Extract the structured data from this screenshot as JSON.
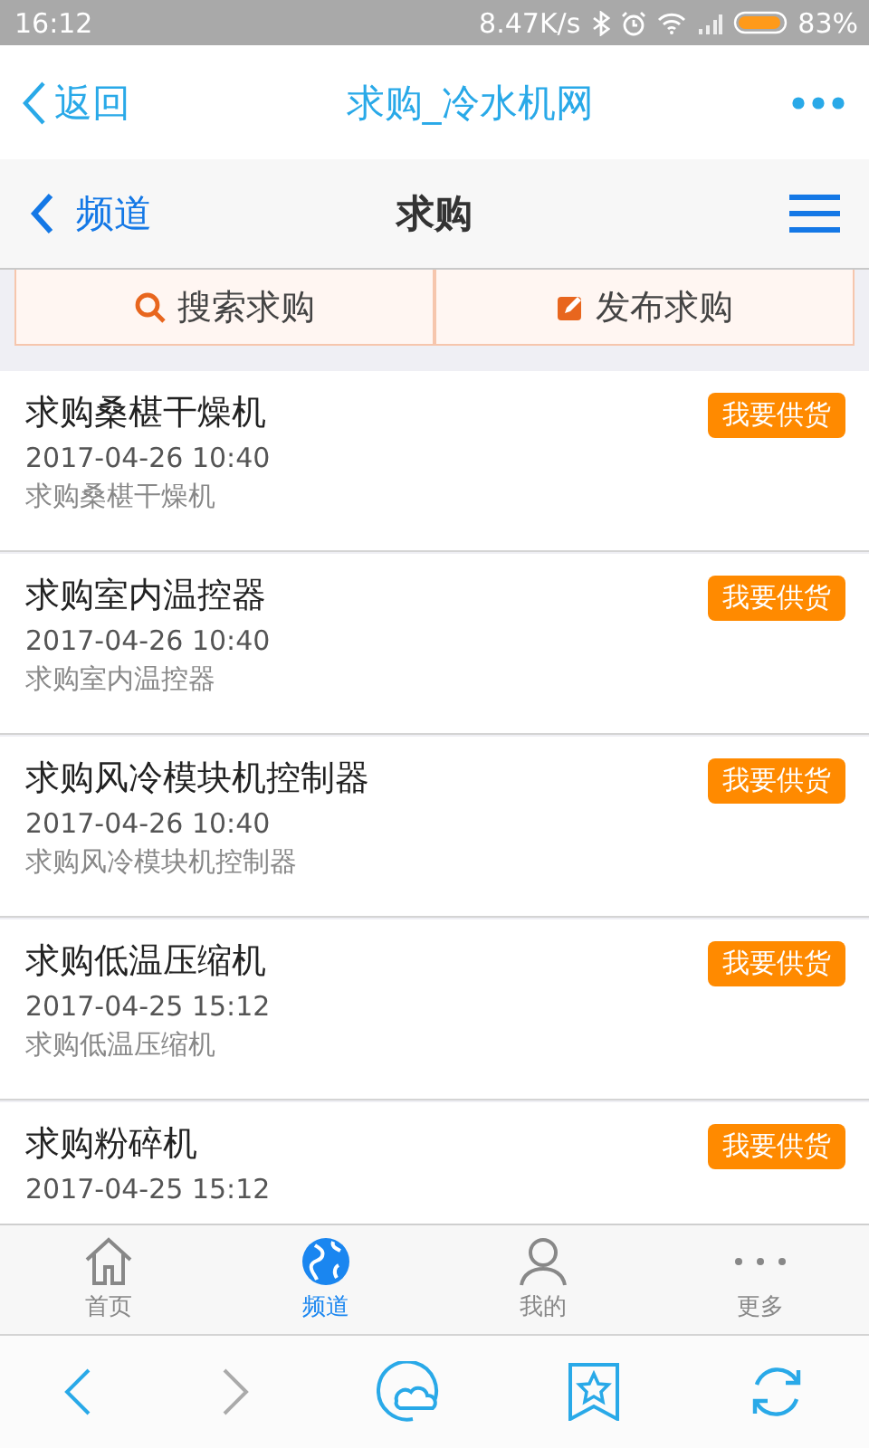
{
  "status_bar": {
    "time": "16:12",
    "speed": "8.47K/s",
    "battery": "83%"
  },
  "browser_header": {
    "back": "返回",
    "title": "求购_冷水机网"
  },
  "channel_bar": {
    "back": "频道",
    "title": "求购"
  },
  "actions": [
    {
      "kind": "search",
      "label": "搜索求购"
    },
    {
      "kind": "post",
      "label": "发布求购"
    }
  ],
  "items": [
    {
      "title": "求购桑椹干燥机",
      "date": "2017-04-26 10:40",
      "description": "求购桑椹干燥机",
      "button": "我要供货"
    },
    {
      "title": "求购室内温控器",
      "date": "2017-04-26 10:40",
      "description": "求购室内温控器",
      "button": "我要供货"
    },
    {
      "title": "求购风冷模块机控制器",
      "date": "2017-04-26 10:40",
      "description": "求购风冷模块机控制器",
      "button": "我要供货"
    },
    {
      "title": "求购低温压缩机",
      "date": "2017-04-25 15:12",
      "description": "求购低温压缩机",
      "button": "我要供货"
    },
    {
      "title": "求购粉碎机",
      "date": "2017-04-25 15:12",
      "button": "我要供货"
    }
  ],
  "tabs": [
    {
      "kind": "home",
      "label": "首页",
      "selected": false
    },
    {
      "kind": "globe",
      "label": "频道",
      "selected": true
    },
    {
      "kind": "person",
      "label": "我的",
      "selected": false
    },
    {
      "kind": "more",
      "label": "更多",
      "selected": false
    }
  ],
  "browser_bar": [
    {
      "kind": "back",
      "disabled": false
    },
    {
      "kind": "forward",
      "disabled": true
    },
    {
      "kind": "cloud",
      "disabled": false
    },
    {
      "kind": "bookmark",
      "disabled": false
    },
    {
      "kind": "refresh",
      "disabled": false
    }
  ]
}
